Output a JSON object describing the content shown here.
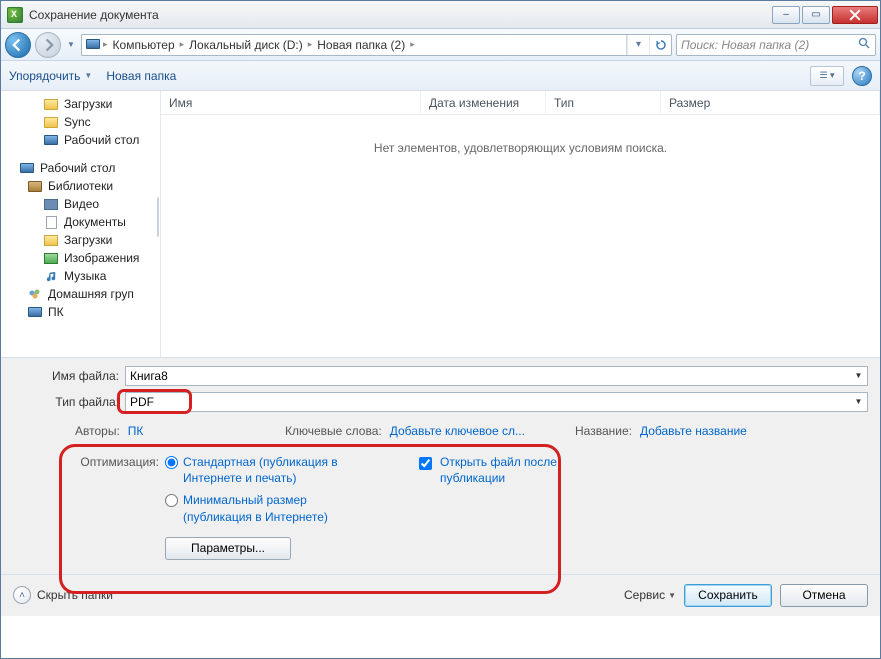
{
  "titlebar": {
    "title": "Сохранение документа"
  },
  "breadcrumb": {
    "segs": [
      "Компьютер",
      "Локальный диск (D:)",
      "Новая папка (2)"
    ]
  },
  "search": {
    "placeholder": "Поиск: Новая папка (2)"
  },
  "toolbar": {
    "organize": "Упорядочить",
    "newfolder": "Новая папка"
  },
  "tree": {
    "top": [
      {
        "label": "Загрузки",
        "icon": "folder"
      },
      {
        "label": "Sync",
        "icon": "folder"
      },
      {
        "label": "Рабочий стол",
        "icon": "monitor"
      }
    ],
    "desktop": "Рабочий стол",
    "libs_label": "Библиотеки",
    "libs": [
      {
        "label": "Видео",
        "icon": "video"
      },
      {
        "label": "Документы",
        "icon": "doc"
      },
      {
        "label": "Загрузки",
        "icon": "download"
      },
      {
        "label": "Изображения",
        "icon": "image"
      },
      {
        "label": "Музыка",
        "icon": "music"
      }
    ],
    "homegroup": "Домашняя груп",
    "pc": "ПК"
  },
  "columns": {
    "name": "Имя",
    "date": "Дата изменения",
    "type": "Тип",
    "size": "Размер"
  },
  "empty_msg": "Нет элементов, удовлетворяющих условиям поиска.",
  "form": {
    "filename_label": "Имя файла:",
    "filename_value": "Книга8",
    "filetype_label": "Тип файла:",
    "filetype_value": "PDF"
  },
  "meta": {
    "authors_label": "Авторы:",
    "authors_value": "ПК",
    "keywords_label": "Ключевые слова:",
    "keywords_value": "Добавьте ключевое сл...",
    "title_label": "Название:",
    "title_value": "Добавьте название"
  },
  "optim": {
    "label": "Оптимизация:",
    "opt_standard": "Стандартная (публикация в Интернете и печать)",
    "opt_min": "Минимальный размер (публикация в Интернете)",
    "open_after": "Открыть файл после публикации",
    "params_btn": "Параметры..."
  },
  "footer": {
    "hide_folders": "Скрыть папки",
    "service": "Сервис",
    "save": "Сохранить",
    "cancel": "Отмена"
  }
}
